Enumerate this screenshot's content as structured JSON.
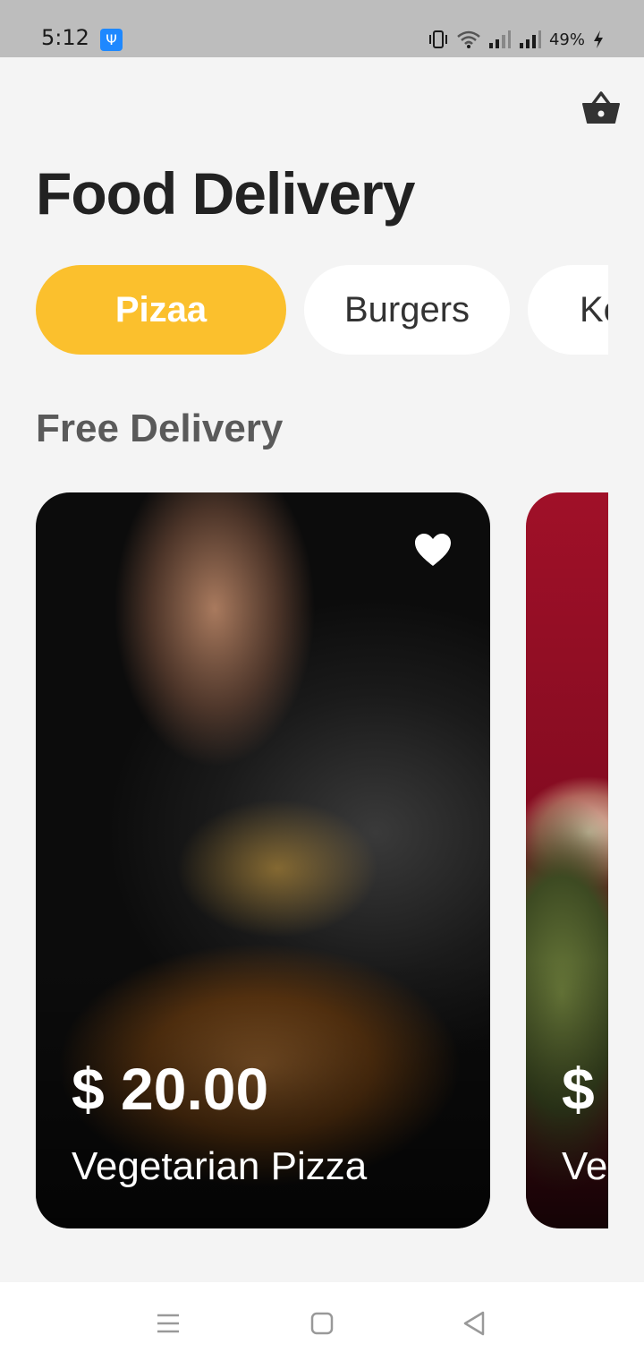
{
  "status_bar": {
    "time": "5:12",
    "usb_icon": "usb-icon",
    "battery_text": "49%",
    "icons": [
      "vibrate-icon",
      "wifi-icon",
      "signal-icon",
      "signal-icon",
      "charging-icon"
    ]
  },
  "header": {
    "title": "Food Delivery",
    "cart_icon": "basket-icon"
  },
  "categories": [
    {
      "label": "Pizaa",
      "active": true
    },
    {
      "label": "Burgers",
      "active": false
    },
    {
      "label": "Ke",
      "active": false
    }
  ],
  "section": {
    "title": "Free Delivery"
  },
  "products": [
    {
      "price": "$ 20.00",
      "name": "Vegetarian Pizza",
      "favorite_icon": "heart-icon"
    },
    {
      "price": "$",
      "name": "Ve"
    }
  ],
  "nav": {
    "icons": [
      "menu-icon",
      "home-icon",
      "back-icon"
    ]
  },
  "colors": {
    "accent": "#fbc02d",
    "background": "#f4f4f4",
    "title": "#222222",
    "section_title": "#5a5a5a"
  }
}
